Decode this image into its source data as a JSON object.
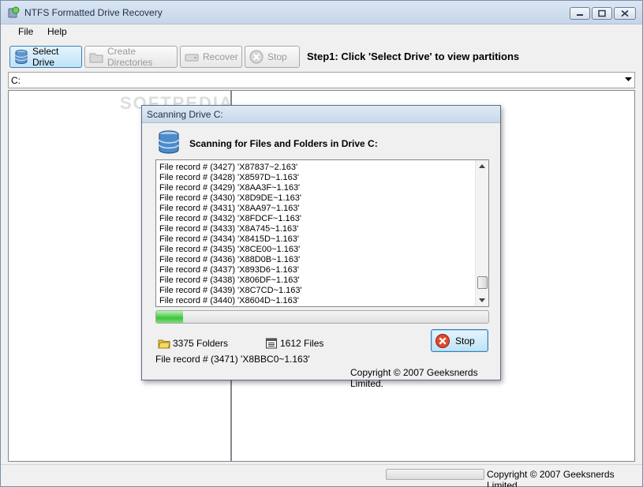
{
  "window": {
    "title": "NTFS Formatted Drive Recovery"
  },
  "menu": {
    "file": "File",
    "help": "Help"
  },
  "toolbar": {
    "select_drive": "Select Drive",
    "create_directories": "Create Directories",
    "recover": "Recover",
    "stop": "Stop",
    "step_text": "Step1: Click 'Select Drive' to view partitions"
  },
  "drive_select": {
    "value": "C:"
  },
  "watermark": "SOFTPEDIA",
  "status": {
    "copyright": "Copyright © 2007 Geeksnerds Limited."
  },
  "dialog": {
    "title": "Scanning Drive C:",
    "heading": "Scanning for Files and Folders in Drive C:",
    "log": [
      "File record # (3427)  'X87837~2.163'",
      "File record # (3428)  'X8597D~1.163'",
      "File record # (3429)  'X8AA3F~1.163'",
      "File record # (3430)  'X8D9DE~1.163'",
      "File record # (3431)  'X8AA97~1.163'",
      "File record # (3432)  'X8FDCF~1.163'",
      "File record # (3433)  'X8A745~1.163'",
      "File record # (3434)  'X8415D~1.163'",
      "File record # (3435)  'X8CE00~1.163'",
      "File record # (3436)  'X88D0B~1.163'",
      "File record # (3437)  'X893D6~1.163'",
      "File record # (3438)  'X806DF~1.163'",
      "File record # (3439)  'X8C7CD~1.163'",
      "File record # (3440)  'X8604D~1.163'"
    ],
    "progress_percent": 8,
    "folders_count": "3375 Folders",
    "files_count": "1612 Files",
    "current_record": "File record # (3471)  'X8BBC0~1.163'",
    "stop": "Stop",
    "copyright": "Copyright © 2007 Geeksnerds Limited."
  },
  "colors": {
    "accent": "#3c7fb1",
    "progress": "#3cc43a",
    "stop_icon": "#e04a2a"
  }
}
